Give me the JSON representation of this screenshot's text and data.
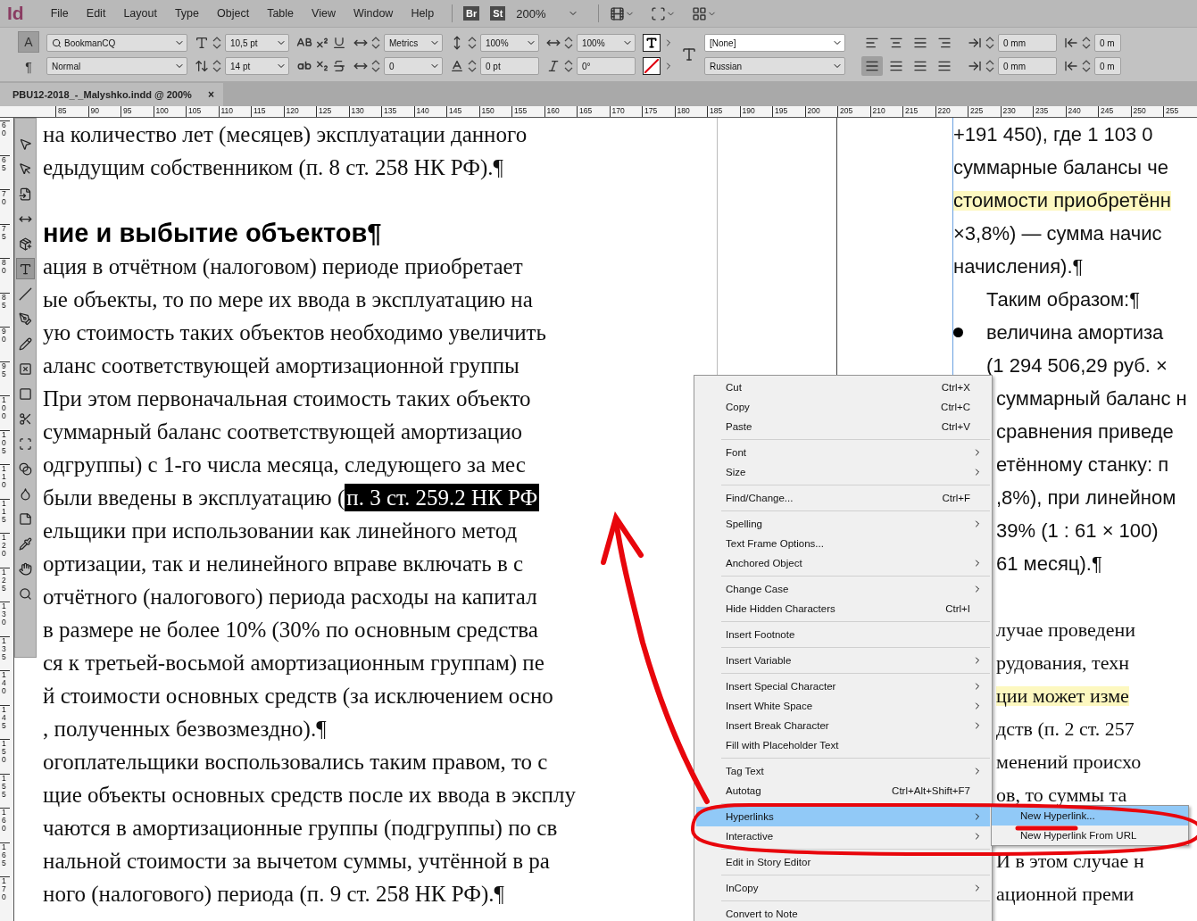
{
  "menu_bar": {
    "logo": "Id",
    "menus": [
      "File",
      "Edit",
      "Layout",
      "Type",
      "Object",
      "Table",
      "View",
      "Window",
      "Help"
    ],
    "badges": [
      "Br",
      "St"
    ],
    "zoom": "200%"
  },
  "control_panel": {
    "mode_buttons": [
      {
        "label": "A",
        "selected": true
      },
      {
        "label": "¶",
        "selected": false
      }
    ],
    "font_family": "BookmanCQ",
    "font_style": "Normal",
    "font_size": "10,5 pt",
    "leading": "14 pt",
    "kerning": "Metrics",
    "tracking": "0",
    "vertical_scale": "100%",
    "baseline_shift": "0 pt",
    "horizontal_scale": "100%",
    "skew": "0°",
    "character_style": "[None]",
    "language": "Russian",
    "align_buttons": [
      {
        "selected": false
      },
      {
        "selected": false
      },
      {
        "selected": false
      },
      {
        "selected": false
      },
      {
        "selected": true
      },
      {
        "selected": false
      },
      {
        "selected": false
      },
      {
        "selected": false
      }
    ],
    "indents": [
      "0 mm",
      "0 m",
      "0 mm",
      "0 m"
    ]
  },
  "document_tab": {
    "title": "PBU12-2018_-_Malyshko.indd @ 200%",
    "close": "×"
  },
  "horizontal_ruler": [
    "85",
    "90",
    "95",
    "100",
    "105",
    "110",
    "115",
    "120",
    "125",
    "130",
    "135",
    "140",
    "145",
    "150",
    "155",
    "160",
    "165",
    "170",
    "175",
    "180",
    "185",
    "190",
    "195",
    "200",
    "205",
    "210",
    "215",
    "220",
    "225",
    "230",
    "235",
    "240",
    "245",
    "250",
    "255"
  ],
  "vertical_ruler": [
    "60",
    "65",
    "70",
    "75",
    "80",
    "85",
    "90",
    "95",
    "100",
    "105",
    "110",
    "115",
    "120",
    "125",
    "130",
    "135",
    "140",
    "145",
    "150",
    "155",
    "160",
    "165",
    "170"
  ],
  "tools": [
    {
      "kind": "selection",
      "selected": false
    },
    {
      "kind": "direct",
      "selected": false
    },
    {
      "kind": "page",
      "selected": false
    },
    {
      "kind": "gap",
      "selected": false
    },
    {
      "kind": "collector",
      "selected": false
    },
    {
      "kind": "type",
      "selected": true
    },
    {
      "kind": "line",
      "selected": false
    },
    {
      "kind": "pen",
      "selected": false
    },
    {
      "kind": "pencil",
      "selected": false
    },
    {
      "kind": "frame",
      "selected": false
    },
    {
      "kind": "rectangle",
      "selected": false
    },
    {
      "kind": "scissors",
      "selected": false
    },
    {
      "kind": "transform",
      "selected": false
    },
    {
      "kind": "gradient",
      "selected": false
    },
    {
      "kind": "feather",
      "selected": false
    },
    {
      "kind": "note",
      "selected": false
    },
    {
      "kind": "eyedropper",
      "selected": false
    },
    {
      "kind": "hand",
      "selected": false
    },
    {
      "kind": "zoom",
      "selected": false
    }
  ],
  "left_column": [
    {
      "kind": "body",
      "text": "на количество лет (месяцев) эксплуатации данного"
    },
    {
      "kind": "body",
      "text": "едыдущим собственником (п. 8 ст. 258 НК РФ).¶"
    },
    {
      "kind": "blank"
    },
    {
      "kind": "heading",
      "text": "ние и выбытие объектов¶"
    },
    {
      "kind": "body",
      "text": "ация в отчётном (налоговом) периоде приобретает"
    },
    {
      "kind": "body",
      "text": "ые объекты, то по мере их ввода в эксплуатацию на"
    },
    {
      "kind": "body",
      "text": "ую стоимость таких объектов необходимо увеличить"
    },
    {
      "kind": "body",
      "text": "аланс соответствующей амортизационной группы"
    },
    {
      "kind": "body",
      "text": "При этом первоначальная стоимость таких объекто"
    },
    {
      "kind": "body",
      "text": "суммарный баланс соответствующей амортизацио"
    },
    {
      "kind": "body",
      "text": "одгруппы) с 1-го числа месяца, следующего за мес"
    },
    {
      "kind": "body",
      "text": "были введены в эксплуатацию (",
      "selection": "п. 3 ст. 259.2 НК РФ"
    },
    {
      "kind": "body",
      "text": "ельщики при использовании как линейного метод"
    },
    {
      "kind": "body",
      "text": "ортизации, так и нелинейного вправе включать в с"
    },
    {
      "kind": "body",
      "text": "отчётного (налогового) периода расходы на капитал"
    },
    {
      "kind": "body",
      "text": "в размере не более 10% (30% по основным средства"
    },
    {
      "kind": "body",
      "text": "ся к третьей-восьмой амортизационным группам) пе"
    },
    {
      "kind": "body",
      "text": "й стоимости основных средств (за исключением осно"
    },
    {
      "kind": "body",
      "text": ", полученных безвозмездно).¶"
    },
    {
      "kind": "body",
      "text": "огоплательщики воспользовались таким правом, то с"
    },
    {
      "kind": "body",
      "text": "щие объекты основных средств после их ввода в эксплу"
    },
    {
      "kind": "body",
      "text": "чаются в амортизационные группы (подгруппы) по св"
    },
    {
      "kind": "body",
      "text": "нальной стоимости за вычетом суммы, учтённой в ра"
    },
    {
      "kind": "body",
      "text": "ного (налогового) периода (п. 9 ст. 258 НК РФ).¶"
    }
  ],
  "right_column": {
    "above_menu": [
      {
        "kind": "sans",
        "text": "+191 450), где 1 103 0"
      },
      {
        "kind": "sans",
        "text": "суммарные балансы че"
      },
      {
        "kind": "sans",
        "text": "стоимости приобретённ",
        "highlighted": true
      },
      {
        "kind": "sans",
        "text": "×3,8%) — сумма начис"
      },
      {
        "kind": "sans",
        "text": "начисления).¶"
      },
      {
        "kind": "sans",
        "text": "Таким образом:¶",
        "indented": true
      },
      {
        "kind": "sans",
        "text": "величина амортиза",
        "bullet": true
      },
      {
        "kind": "sans",
        "text": "(1 294 506,29 руб. ×",
        "indented": true
      }
    ],
    "beside_menu": [
      {
        "kind": "sans",
        "text": "суммарный баланс н"
      },
      {
        "kind": "sans",
        "text": "сравнения приведе"
      },
      {
        "kind": "sans",
        "text": "етённому станку: п"
      },
      {
        "kind": "sans",
        "text": ",8%), при линейном"
      },
      {
        "kind": "sans",
        "text": "39% (1 : 61 × 100)"
      },
      {
        "kind": "sans",
        "text": "61 месяц).¶"
      },
      {
        "kind": "blank"
      },
      {
        "kind": "serif",
        "text": "лучае проведени"
      },
      {
        "kind": "serif",
        "text": "рудования, техн"
      },
      {
        "kind": "serif",
        "text": "ции может изме",
        "highlighted": true
      },
      {
        "kind": "serif",
        "text": "дств (п. 2 ст. 257"
      },
      {
        "kind": "serif",
        "text": "менений происхо"
      },
      {
        "kind": "serif",
        "text": "ов, то суммы та"
      },
      {
        "kind": "blank"
      },
      {
        "kind": "serif",
        "text": "И в этом случае н"
      },
      {
        "kind": "serif",
        "text": "ационной преми"
      }
    ]
  },
  "context_menu": {
    "groups": [
      [
        {
          "label": "Cut",
          "shortcut": "Ctrl+X",
          "submenu": false,
          "selected": false
        },
        {
          "label": "Copy",
          "shortcut": "Ctrl+C",
          "submenu": false,
          "selected": false
        },
        {
          "label": "Paste",
          "shortcut": "Ctrl+V",
          "submenu": false,
          "selected": false
        }
      ],
      [
        {
          "label": "Font",
          "submenu": true,
          "selected": false
        },
        {
          "label": "Size",
          "submenu": true,
          "selected": false
        }
      ],
      [
        {
          "label": "Find/Change...",
          "shortcut": "Ctrl+F",
          "submenu": false,
          "selected": false
        }
      ],
      [
        {
          "label": "Spelling",
          "submenu": true,
          "selected": false
        },
        {
          "label": "Text Frame Options...",
          "submenu": false,
          "selected": false
        },
        {
          "label": "Anchored Object",
          "submenu": true,
          "selected": false
        }
      ],
      [
        {
          "label": "Change Case",
          "submenu": true,
          "selected": false
        },
        {
          "label": "Hide Hidden Characters",
          "shortcut": "Ctrl+I",
          "submenu": false,
          "selected": false
        }
      ],
      [
        {
          "label": "Insert Footnote",
          "submenu": false,
          "selected": false
        }
      ],
      [
        {
          "label": "Insert Variable",
          "submenu": true,
          "selected": false
        }
      ],
      [
        {
          "label": "Insert Special Character",
          "submenu": true,
          "selected": false
        },
        {
          "label": "Insert White Space",
          "submenu": true,
          "selected": false
        },
        {
          "label": "Insert Break Character",
          "submenu": true,
          "selected": false
        },
        {
          "label": "Fill with Placeholder Text",
          "submenu": false,
          "selected": false
        }
      ],
      [
        {
          "label": "Tag Text",
          "submenu": true,
          "selected": false
        },
        {
          "label": "Autotag",
          "shortcut": "Ctrl+Alt+Shift+F7",
          "submenu": false,
          "selected": false
        }
      ],
      [
        {
          "label": "Hyperlinks",
          "submenu": true,
          "selected": true
        },
        {
          "label": "Interactive",
          "submenu": true,
          "selected": false
        }
      ],
      [
        {
          "label": "Edit in Story Editor",
          "submenu": false,
          "selected": false
        }
      ],
      [
        {
          "label": "InCopy",
          "submenu": true,
          "selected": false
        }
      ],
      [
        {
          "label": "Convert to Note",
          "submenu": false,
          "selected": false
        }
      ]
    ]
  },
  "submenu": [
    {
      "label": "New Hyperlink...",
      "selected": true
    },
    {
      "label": "New Hyperlink From URL",
      "selected": false
    }
  ]
}
